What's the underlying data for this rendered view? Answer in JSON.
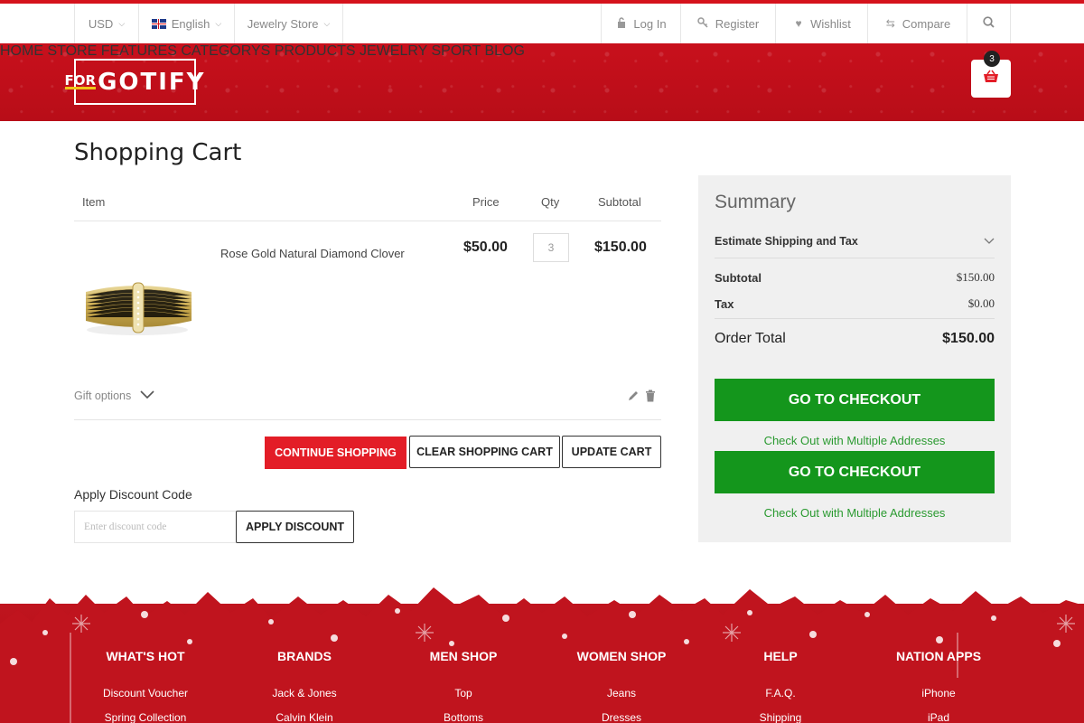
{
  "topbar": {
    "currency": "USD",
    "language": "English",
    "store": "Jewelry Store",
    "login": "Log In",
    "register": "Register",
    "wishlist": "Wishlist",
    "compare": "Compare"
  },
  "brand": {
    "for": "FOR",
    "name": "GOTIFY"
  },
  "nav": [
    "HOME STORE",
    "FEATURES",
    "CATEGORYS",
    "PRODUCTS",
    "JEWELRY",
    "SPORT",
    "BLOG"
  ],
  "cart": {
    "count": "3"
  },
  "page": {
    "title": "Shopping Cart"
  },
  "table": {
    "headers": {
      "item": "Item",
      "price": "Price",
      "qty": "Qty",
      "subtotal": "Subtotal"
    },
    "rows": [
      {
        "name": "Rose Gold Natural Diamond Clover",
        "price": "$50.00",
        "qty": "3",
        "subtotal": "$150.00"
      }
    ]
  },
  "gift_options": "Gift options",
  "actions": {
    "continue": "CONTINUE SHOPPING",
    "clear": "CLEAR SHOPPING CART",
    "update": "UPDATE CART"
  },
  "discount": {
    "label": "Apply Discount Code",
    "placeholder": "Enter discount code",
    "button": "APPLY DISCOUNT"
  },
  "summary": {
    "title": "Summary",
    "estimate": "Estimate Shipping and Tax",
    "subtotal_label": "Subtotal",
    "subtotal": "$150.00",
    "tax_label": "Tax",
    "tax": "$0.00",
    "total_label": "Order Total",
    "total": "$150.00",
    "checkout": "GO TO CHECKOUT",
    "multi": "Check Out with Multiple Addresses"
  },
  "footer": [
    {
      "title": "WHAT'S HOT",
      "items": [
        "Discount Voucher",
        "Spring Collection"
      ]
    },
    {
      "title": "BRANDS",
      "items": [
        "Jack & Jones",
        "Calvin Klein"
      ]
    },
    {
      "title": "MEN SHOP",
      "items": [
        "Top",
        "Bottoms"
      ]
    },
    {
      "title": "WOMEN SHOP",
      "items": [
        "Jeans",
        "Dresses"
      ]
    },
    {
      "title": "HELP",
      "items": [
        "F.A.Q.",
        "Shipping"
      ]
    },
    {
      "title": "NATION APPS",
      "items": [
        "iPhone",
        "iPad"
      ]
    }
  ],
  "colors": {
    "brand_red": "#d5121c",
    "checkout_green": "#14961c",
    "link_green": "#2a9a30"
  }
}
